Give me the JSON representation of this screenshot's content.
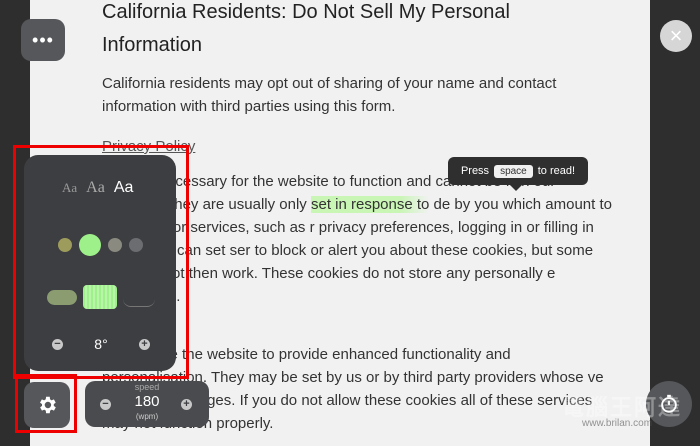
{
  "document": {
    "title": "California Residents: Do Not Sell My Personal Information",
    "intro": "California residents may opt out of sharing of your name and contact information with third parties using this form.",
    "privacy_link": "Privacy Policy",
    "para2_before": "kies are necessary for the website to function and cannot be ff in our systems. They are usually only ",
    "para2_highlight": "set in response to",
    "para2_after": " de by you which amount to a request for services, such as r privacy preferences, logging in or filling in forms.  You can set ser to block or alert you about these cookies, but some parts of l not then work. These cookies do not store any personally e information.",
    "para3": "kies enable the website to provide enhanced functionality and personalisation. They may be set by us or by third party providers whose ve added to our pages.  If you do not allow these cookies all of these services may not function properly."
  },
  "tooltip": {
    "prefix": "Press",
    "key": "space",
    "suffix": "to read!"
  },
  "top_bar": {
    "menu_glyph": "•••",
    "close_glyph": "×"
  },
  "settings": {
    "font_options": [
      "Aa",
      "Aa",
      "Aa"
    ],
    "colors": [
      "#9e9c5c",
      "#9ef08a",
      "#8a8a80",
      "#6c6d70"
    ],
    "temperature_value": "8°",
    "minus_glyph": "−",
    "plus_glyph": "+"
  },
  "speed": {
    "label": "speed",
    "value": "180",
    "unit": "(wpm)"
  },
  "watermark": {
    "text": "電腦王阿達",
    "url": "www.brilan.com"
  }
}
